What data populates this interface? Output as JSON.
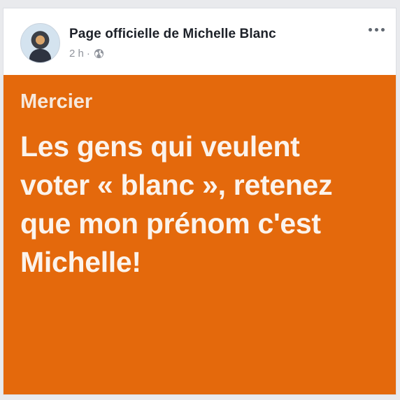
{
  "post": {
    "author": "Page officielle de Michelle Blanc",
    "time": "2 h",
    "separator": "·",
    "privacy_icon": "globe-icon",
    "menu_icon": "more-options-icon",
    "image": {
      "background_color": "#e4690c",
      "kicker": "Mercier",
      "headline_lines": [
        "Les gens qui veulent",
        "voter « blanc », retenez",
        "que mon prénom c'est",
        "Michelle!"
      ]
    }
  }
}
